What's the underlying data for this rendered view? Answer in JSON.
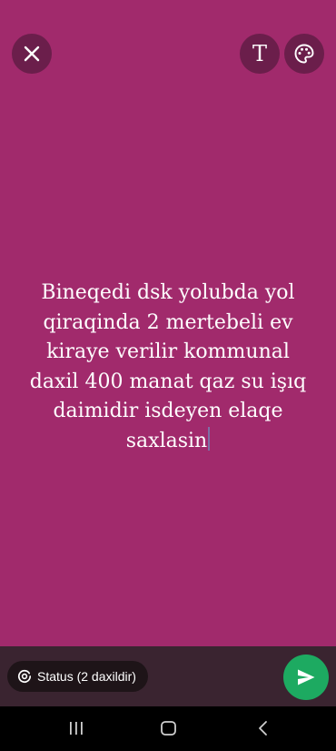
{
  "composer": {
    "background_color": "#A12A6C",
    "text": "Bineqedi dsk yolubda yol\nqiraqinda 2 mertebeli ev\nkiraye verilir kommunal\ndaxil 400 manat qaz su işıq\ndaimidir isdeyen elaqe\nsaxlasin"
  },
  "toolbar": {
    "close_icon": "close-icon",
    "text_tool_label": "T",
    "palette_icon": "palette-icon"
  },
  "footer": {
    "audience_label": "Status (2 daxildir)",
    "audience_icon": "status-ring-icon",
    "send_icon": "send-icon",
    "send_color": "#1DAA61"
  },
  "navigation": {
    "recents_icon": "recents-icon",
    "home_icon": "home-icon",
    "back_icon": "back-icon"
  }
}
